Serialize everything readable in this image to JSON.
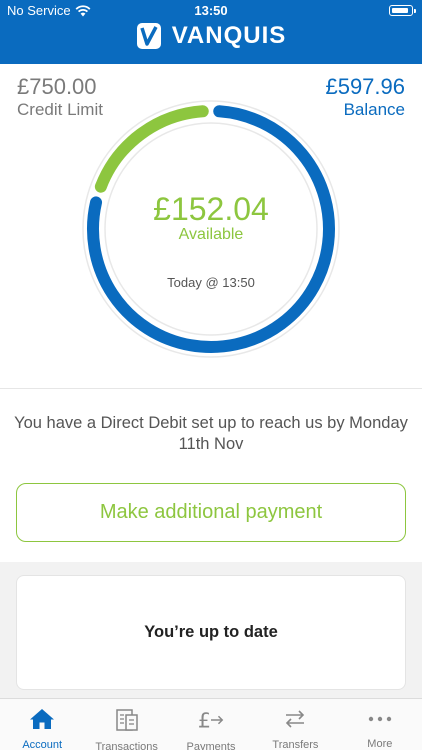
{
  "status_bar": {
    "carrier": "No Service",
    "time": "13:50"
  },
  "header": {
    "brand": "VANQUIS"
  },
  "colors": {
    "brand_blue": "#0a6bbf",
    "accent_green": "#8dc63f"
  },
  "summary": {
    "credit_limit_amount": "£750.00",
    "credit_limit_label": "Credit Limit",
    "balance_amount": "£597.96",
    "balance_label": "Balance",
    "available_amount": "£152.04",
    "available_label": "Available",
    "timestamp": "Today @ 13:50",
    "credit_limit_value": 750.0,
    "balance_value": 597.96,
    "available_value": 152.04
  },
  "direct_debit": {
    "message": "You have a Direct Debit set up to reach us by Monday 11th Nov"
  },
  "actions": {
    "make_payment_label": "Make additional payment"
  },
  "status_card": {
    "title": "You’re up to date"
  },
  "tabs": [
    {
      "label": "Account",
      "icon": "home-icon"
    },
    {
      "label": "Transactions",
      "icon": "receipt-icon"
    },
    {
      "label": "Payments",
      "icon": "pound-arrow-icon"
    },
    {
      "label": "Transfers",
      "icon": "transfer-arrows-icon"
    },
    {
      "label": "More",
      "icon": "more-icon"
    }
  ]
}
